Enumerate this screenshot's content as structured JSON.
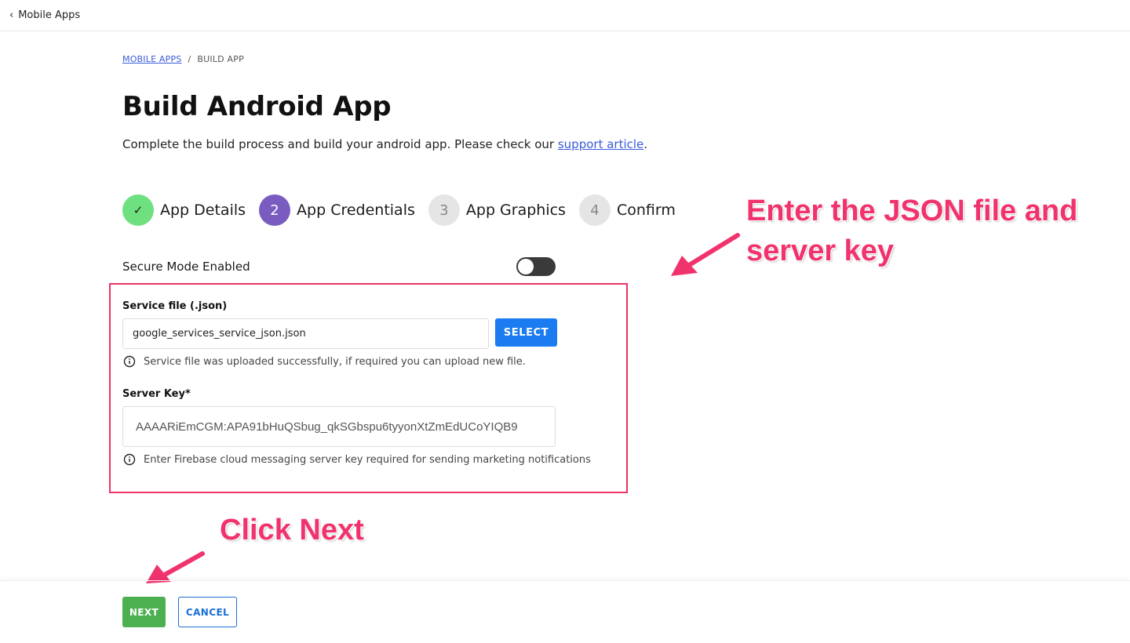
{
  "topbar": {
    "back_label": "Mobile Apps",
    "back_icon": "chevron-left-icon"
  },
  "breadcrumb": {
    "link": "MOBILE APPS",
    "separator": "/",
    "current": "BUILD APP"
  },
  "page": {
    "title": "Build Android App",
    "subtitle_prefix": "Complete the build process and build your android app. Please check our ",
    "subtitle_link": "support article",
    "subtitle_suffix": "."
  },
  "stepper": {
    "steps": [
      {
        "marker": "✓",
        "label": "App Details",
        "state": "done"
      },
      {
        "marker": "2",
        "label": "App Credentials",
        "state": "active"
      },
      {
        "marker": "3",
        "label": "App Graphics",
        "state": "todo"
      },
      {
        "marker": "4",
        "label": "Confirm",
        "state": "todo"
      }
    ]
  },
  "secure_mode": {
    "label": "Secure Mode Enabled",
    "enabled": false
  },
  "service_file": {
    "label": "Service file (.json)",
    "value": "google_services_service_json.json",
    "button": "SELECT",
    "hint": "Service file was uploaded successfully, if required you can upload new file."
  },
  "server_key": {
    "label": "Server Key*",
    "value": "AAAARiEmCGM:APA91bHuQSbug_qkSGbspu6tyyonXtZmEdUCoYIQB9",
    "hint": "Enter Firebase cloud messaging server key required for sending marketing notifications"
  },
  "annotations": {
    "json_hint": "Enter the JSON file and server key",
    "next_hint": "Click Next"
  },
  "footer": {
    "next": "NEXT",
    "cancel": "CANCEL"
  },
  "colors": {
    "accent_blue": "#1a7cf0",
    "step_done": "#6ee07f",
    "step_active": "#7a5bc0",
    "next_green": "#4cb050",
    "annotation_pink": "#f1336d"
  }
}
